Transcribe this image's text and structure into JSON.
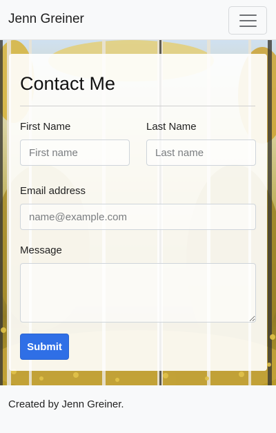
{
  "navbar": {
    "brand": "Jenn Greiner",
    "toggle_icon": "hamburger-menu-icon"
  },
  "contact_form": {
    "title": "Contact Me",
    "first_name": {
      "label": "First Name",
      "placeholder": "First name",
      "value": ""
    },
    "last_name": {
      "label": "Last Name",
      "placeholder": "Last name",
      "value": ""
    },
    "email": {
      "label": "Email address",
      "placeholder": "name@example.com",
      "value": ""
    },
    "message": {
      "label": "Message",
      "placeholder": "",
      "value": ""
    },
    "submit_label": "Submit"
  },
  "footer": {
    "text": "Created by Jenn Greiner."
  },
  "colors": {
    "navbar_bg": "#f8f9fa",
    "submit_bg": "#2f6fe6",
    "card_bg": "rgba(255,255,255,0.90)"
  }
}
